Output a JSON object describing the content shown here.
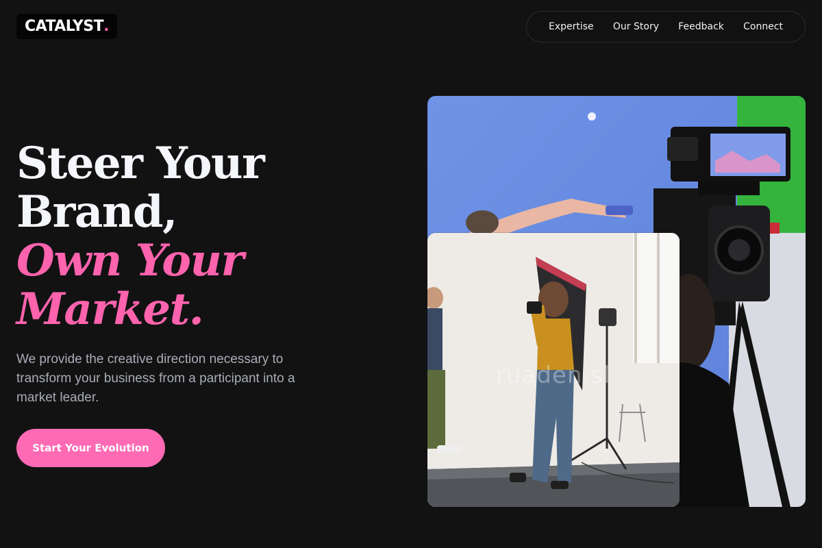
{
  "header": {
    "logo_text": "CATALYST",
    "logo_dot": ".",
    "nav": [
      {
        "label": "Expertise"
      },
      {
        "label": "Our Story"
      },
      {
        "label": "Feedback"
      },
      {
        "label": "Connect"
      }
    ]
  },
  "hero": {
    "headline": {
      "line1": "Steer Your",
      "line2": "Brand,",
      "line3": "Own Your",
      "line4": "Market."
    },
    "subtext": "We provide the creative direction necessary to transform your business from a participant into a market leader.",
    "cta_label": "Start Your Evolution"
  },
  "images": {
    "back_alt": "Film set with camera rig and blue screen",
    "front_alt": "Photographer shooting a model in a studio",
    "watermark": "ruaden.sl"
  },
  "colors": {
    "background": "#121213",
    "accent": "#ff63ad",
    "cta": "#ff6ab4",
    "text_muted": "#a9adb6"
  }
}
